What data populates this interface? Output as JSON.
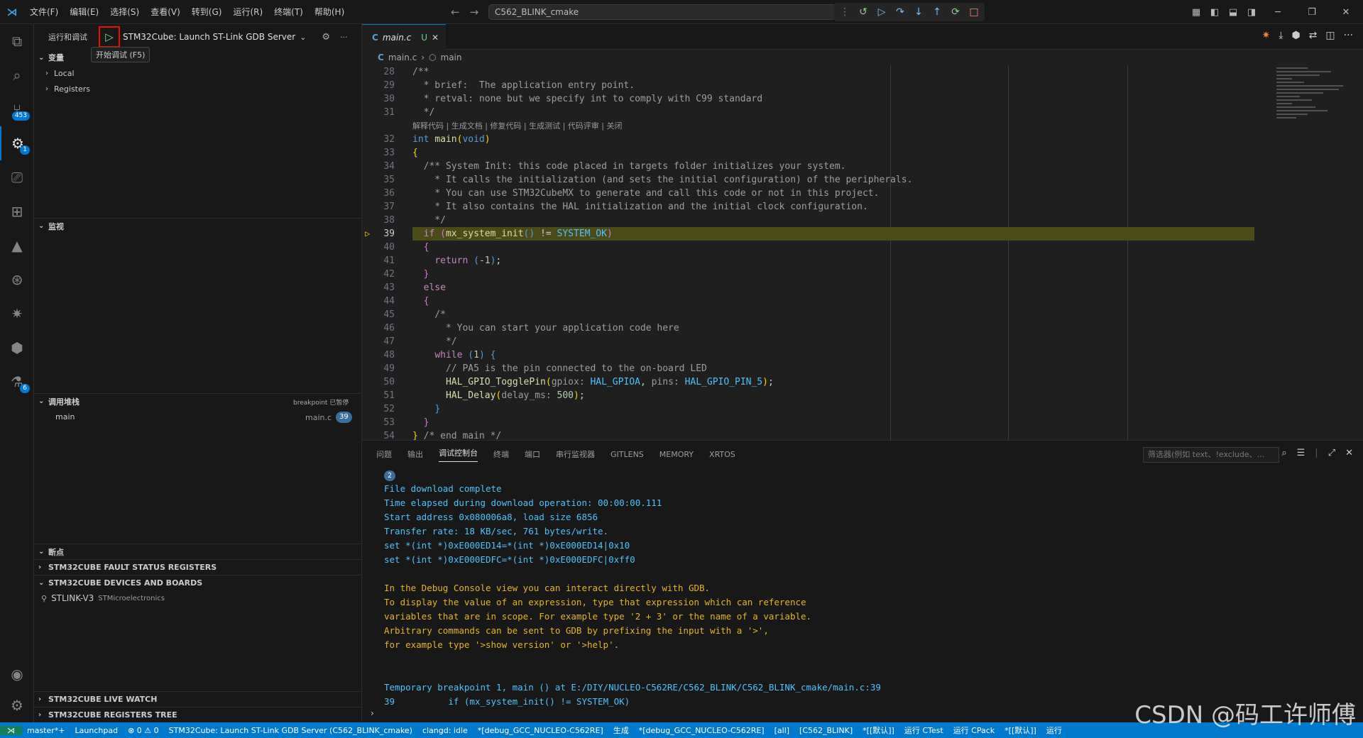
{
  "titlebar": {
    "menu": [
      "文件(F)",
      "编辑(E)",
      "选择(S)",
      "查看(V)",
      "转到(G)",
      "运行(R)",
      "终端(T)",
      "帮助(H)"
    ],
    "search": "C562_BLINK_cmake"
  },
  "activity": {
    "source_control_badge": "453",
    "debug_badge": "1",
    "test_badge": "6"
  },
  "sidebar": {
    "title": "运行和调试",
    "config": "STM32Cube: Launch ST-Link GDB Server",
    "tooltip": "开始调试 (F5)",
    "variables_title": "变量",
    "variables": [
      "Local",
      "Registers"
    ],
    "watch_title": "监视",
    "callstack_title": "调用堆栈",
    "callstack_tag": "breakpoint 已暂停",
    "callstack_frame": "main",
    "callstack_file": "main.c",
    "callstack_line": "39",
    "breakpoints_title": "断点",
    "fault_title": "STM32CUBE FAULT STATUS REGISTERS",
    "devices_title": "STM32CUBE DEVICES AND BOARDS",
    "device_name": "STLINK-V3",
    "device_vendor": "STMicroelectronics",
    "livewatch_title": "STM32CUBE LIVE WATCH",
    "regtree_title": "STM32CUBE REGISTERS TREE"
  },
  "editor": {
    "tab_label": "main.c",
    "tab_status": "U",
    "breadcrumb_file": "main.c",
    "breadcrumb_symbol": "main",
    "codelens": "解释代码 | 生成文档 | 修复代码 | 生成测试 | 代码评审 | 关闭",
    "line_numbers": [
      "28",
      "29",
      "30",
      "31",
      "32",
      "33",
      "34",
      "35",
      "36",
      "37",
      "38",
      "39",
      "40",
      "41",
      "42",
      "43",
      "44",
      "45",
      "46",
      "47",
      "48",
      "49",
      "50",
      "51",
      "52",
      "53",
      "54"
    ]
  },
  "panel": {
    "tabs": [
      "问题",
      "输出",
      "调试控制台",
      "终端",
      "端口",
      "串行监视器",
      "GITLENS",
      "MEMORY",
      "XRTOS"
    ],
    "filter_placeholder": "筛选器(例如 text、!exclude、...",
    "console_count": "2",
    "console_lines_blue": [
      "File download complete",
      "Time elapsed during download operation: 00:00:00.111",
      "Start address 0x080006a8, load size 6856",
      "Transfer rate: 18 KB/sec, 761 bytes/write.",
      "set *(int *)0xE000ED14=*(int *)0xE000ED14|0x10",
      "set *(int *)0xE000EDFC=*(int *)0xE000EDFC|0xff0"
    ],
    "console_lines_orange": [
      "In the Debug Console view you can interact directly with GDB.",
      "To display the value of an expression, type that expression which can reference",
      "variables that are in scope. For example type '2 + 3' or the name of a variable.",
      "Arbitrary commands can be sent to GDB by prefixing the input with a '>',",
      "for example type '>show version' or '>help'."
    ],
    "console_bp_line": "Temporary breakpoint 1, main () at E:/DIY/NUCLEO-C562RE/C562_BLINK/C562_BLINK_cmake/main.c:39",
    "console_src_line": "39\t    if (mx_system_init() != SYSTEM_OK)"
  },
  "statusbar": {
    "items": [
      "master*+",
      "Launchpad",
      "⊗ 0 ⚠ 0",
      "STM32Cube: Launch ST-Link GDB Server (C562_BLINK_cmake)",
      "clangd: idle",
      "*[debug_GCC_NUCLEO-C562RE]",
      "生成",
      "*[debug_GCC_NUCLEO-C562RE]",
      "[all]",
      "[C562_BLINK]",
      "*[[默认]]",
      "运行 CTest",
      "运行 CPack",
      "*[[默认]]",
      "运行"
    ]
  },
  "watermark": "CSDN @码工许师傅",
  "colors": {
    "accent": "#007acc",
    "highlight_line": "#4b4b18",
    "breakpoint_arrow": "#ffcc00"
  }
}
